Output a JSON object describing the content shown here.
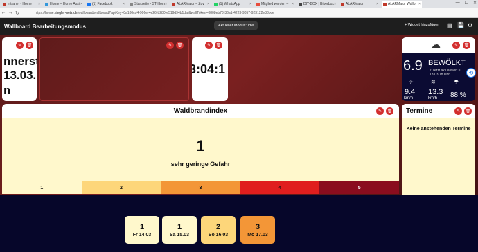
{
  "browser": {
    "tabs": [
      {
        "label": "Intranet - Home",
        "color": "#c0392b"
      },
      {
        "label": "Home – Home Assi",
        "color": "#3498db"
      },
      {
        "label": "(1) Facebook",
        "color": "#1877f2"
      },
      {
        "label": "Startseite - ST-Hom",
        "color": "#888888"
      },
      {
        "label": "ALARMator – Zuv",
        "color": "#c0392b"
      },
      {
        "label": "(1) WhatsApp",
        "color": "#25d366"
      },
      {
        "label": "Mitglied werden –",
        "color": "#e74c3c"
      },
      {
        "label": "DIY-BOX | Biberbox",
        "color": "#444444"
      },
      {
        "label": "ALARMator",
        "color": "#c0392b"
      },
      {
        "label": "ALARMator Wallb",
        "color": "#c0392b"
      }
    ],
    "url_prefix": "https://home.",
    "url_host": "ziegler-netz.de",
    "url_rest": "/wallboard/wallboard?apiKey=0a180cd4-906e-4e26-b280-e519d94b1daf&wallToken=0808eb78-36a1-4223-9057-923122e38bce"
  },
  "app": {
    "title": "Wallboard Bearbeitungsmodus",
    "mode_button": "Aktueller Modus: Idle",
    "add_widget": "Widget hinzufügen",
    "add_icon": "+",
    "pdf_icon": "▤",
    "save_icon": "💾",
    "gear_icon": "⚙"
  },
  "widgets": {
    "day_text": "nnerst",
    "date_text": "13.03.",
    "date_extra": "n",
    "clock_text": "3:04:1",
    "weather": {
      "temp": "6.9",
      "condition": "BEWÖLKT",
      "updated_line1": "Zuletzt aktualisiert u",
      "updated_line2": "13:03:18 Uhr",
      "wind": "9.4",
      "wind_unit": "km/h",
      "gust": "13.3",
      "gust_unit": "km/h",
      "humidity": "88 %"
    },
    "waldbrand": {
      "title": "Waldbrandindex",
      "current": "1",
      "label": "sehr geringe Gefahr",
      "scale": [
        {
          "n": "1",
          "color": "#fff8cc"
        },
        {
          "n": "2",
          "color": "#fdd67a"
        },
        {
          "n": "3",
          "color": "#f39637"
        },
        {
          "n": "4",
          "color": "#e01e1e"
        },
        {
          "n": "5",
          "color": "#8a0d1e"
        }
      ],
      "forecast": [
        {
          "n": "1",
          "d": "Fr 14.03",
          "color": "#fff8cc"
        },
        {
          "n": "1",
          "d": "Sa 15.03",
          "color": "#fff8cc"
        },
        {
          "n": "2",
          "d": "So 16.03",
          "color": "#fdd67a"
        },
        {
          "n": "3",
          "d": "Mo 17.03",
          "color": "#f39637"
        }
      ]
    },
    "termine": {
      "title": "Termine",
      "empty": "Keine anstehenden Termine"
    }
  }
}
